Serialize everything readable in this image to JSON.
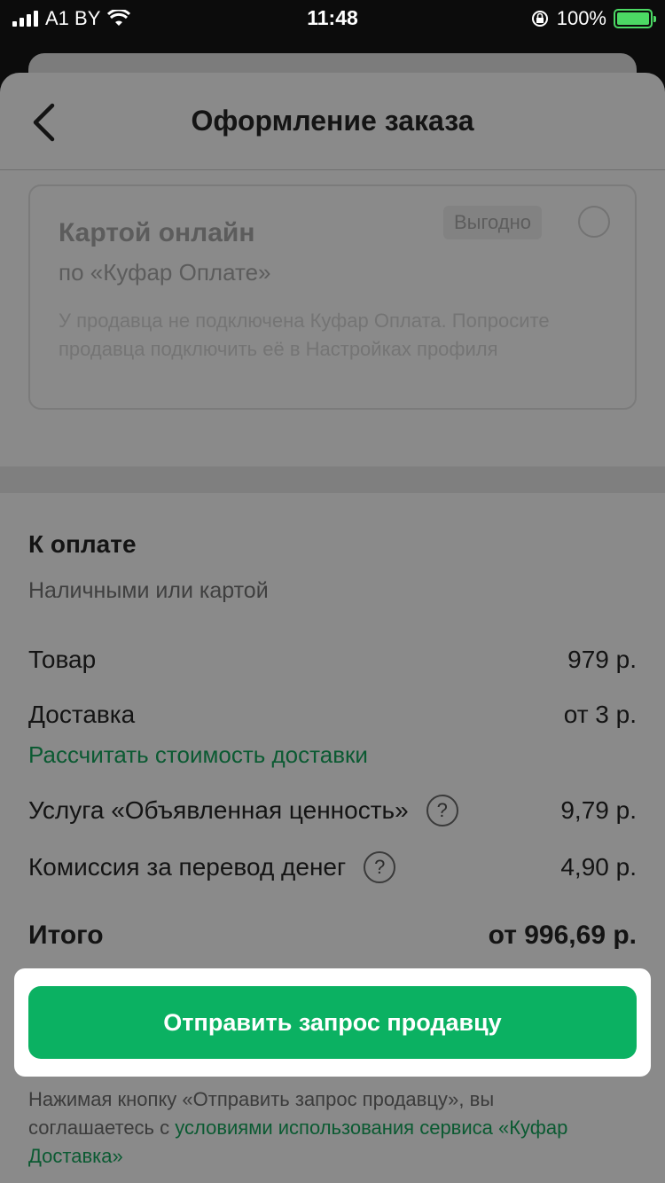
{
  "status_bar": {
    "carrier": "A1 BY",
    "time": "11:48",
    "battery": "100%"
  },
  "header": {
    "title": "Оформление заказа"
  },
  "payment_option": {
    "title": "Картой онлайн",
    "subtitle": "по «Куфар Оплате»",
    "badge": "Выгодно",
    "note": "У продавца не подключена Куфар Оплата. Попросите продавца подключить её в Настройках профиля"
  },
  "summary": {
    "title": "К оплате",
    "subtitle": "Наличными или картой",
    "rows": [
      {
        "label": "Товар",
        "value": "979 р."
      },
      {
        "label": "Доставка",
        "value": "от 3 р."
      },
      {
        "label": "Услуга «Объявленная ценность»",
        "value": "9,79 р."
      },
      {
        "label": "Комиссия за перевод денег",
        "value": "4,90 р."
      }
    ],
    "calc_link": "Рассчитать стоимость доставки",
    "total_label": "Итого",
    "total_value": "от 996,69 р."
  },
  "cta": {
    "label": "Отправить запрос продавцу"
  },
  "footer": {
    "text": "Нажимая кнопку «Отправить запрос продавцу», вы соглашаетесь с ",
    "link": "условиями использования сервиса «Куфар Доставка»"
  },
  "colors": {
    "accent": "#0bb162",
    "link": "#0b5a32"
  }
}
